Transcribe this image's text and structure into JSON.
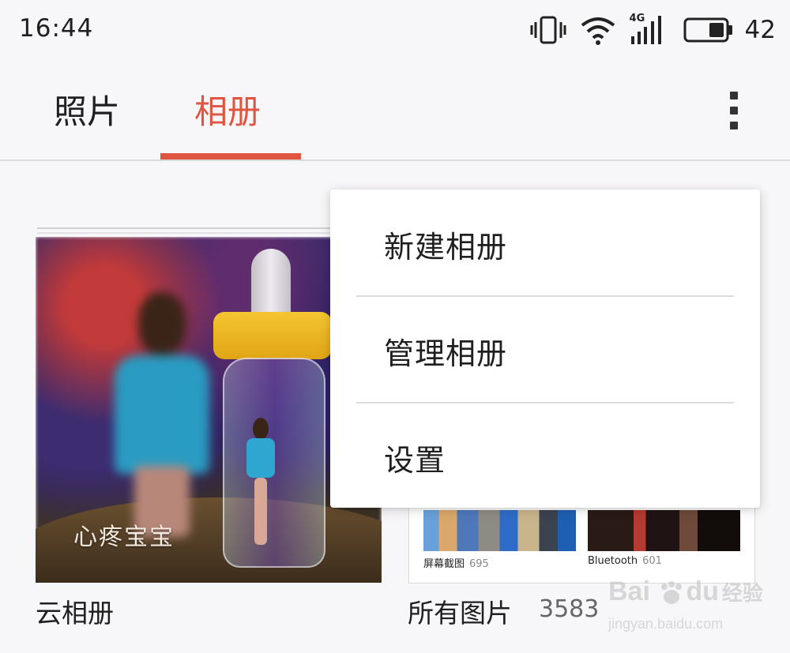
{
  "status_bar": {
    "time": "16:44",
    "network_type": "4G",
    "battery_level": "42",
    "icons": [
      "vibrate-icon",
      "wifi-icon",
      "cell-signal-icon",
      "battery-icon"
    ]
  },
  "tabs": [
    {
      "label": "照片",
      "active": false
    },
    {
      "label": "相册",
      "active": true
    }
  ],
  "accent_color": "#e0553f",
  "overflow_icon": "more-vertical-icon",
  "menu": {
    "items": [
      {
        "label": "新建相册"
      },
      {
        "label": "管理相册"
      },
      {
        "label": "设置"
      }
    ]
  },
  "albums": [
    {
      "name": "云相册",
      "cover_caption": "心疼宝宝"
    },
    {
      "name": "所有图片",
      "count": "3583",
      "sub_albums": [
        {
          "name": "屏幕截图",
          "count": "695"
        },
        {
          "name": "Bluetooth",
          "count": "601"
        }
      ]
    }
  ],
  "watermark": {
    "brand": "Bai",
    "brand_suffix": "du",
    "cn": "经验",
    "url": "jingyan.baidu.com"
  }
}
